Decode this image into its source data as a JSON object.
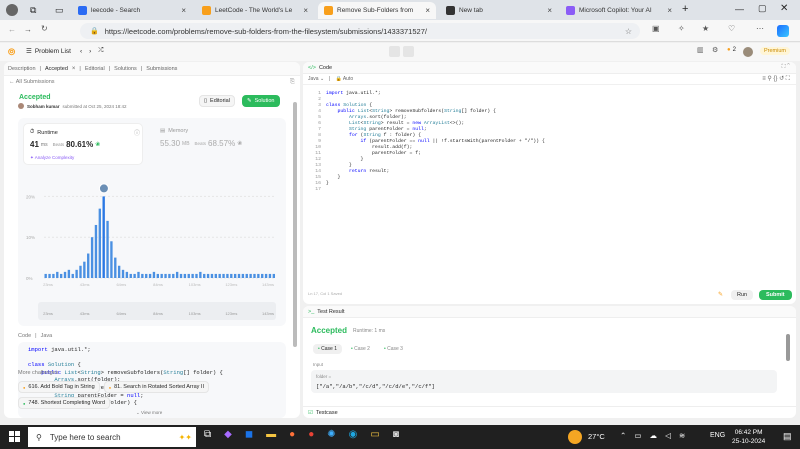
{
  "browser": {
    "tabs": [
      {
        "label": "leecode - Search",
        "color": "#2b6bf3",
        "active": false
      },
      {
        "label": "LeetCode - The World's Le",
        "color": "#f89f1b",
        "active": false
      },
      {
        "label": "Remove Sub-Folders from",
        "color": "#f89f1b",
        "active": true
      },
      {
        "label": "New tab",
        "color": "#333333",
        "active": false
      },
      {
        "label": "Microsoft Copilot: Your AI",
        "color": "#8b5cf6",
        "active": false
      }
    ],
    "url": "https://leetcode.com/problems/remove-sub-folders-from-the-filesystem/submissions/1433371527/"
  },
  "lc": {
    "problem_list": "Problem List",
    "premium": "Premium",
    "streak": "2"
  },
  "left": {
    "tabs": [
      "Description",
      "Accepted",
      "Editorial",
      "Solutions",
      "Submissions"
    ],
    "back": "All Submissions",
    "status": "Accepted",
    "user": "Sobham kumar",
    "submitted": "submitted at Oct 25, 2024 18:42",
    "editorial_btn": "Editorial",
    "solution_btn": "Solution",
    "runtime_label": "Runtime",
    "runtime_value": "41",
    "runtime_unit": "ms",
    "beats_label": "Beats",
    "runtime_beats": "80.61%",
    "analyze": "Analyze Complexity",
    "memory_label": "Memory",
    "memory_value": "55.30",
    "memory_unit": "MB",
    "memory_beats": "68.57%",
    "y_ticks": [
      "20%",
      "10%",
      "0%"
    ],
    "x_ticks": [
      "23ms",
      "43ms",
      "64ms",
      "84ms",
      "103ms",
      "123ms",
      "143ms"
    ],
    "code_label": "Code",
    "lang": "Java",
    "view_more": "View more",
    "more_label": "More challenges",
    "challenges": [
      "616. Add Bold Tag in String",
      "81. Search in Rotated Sorted Array II",
      "748. Shortest Completing Word"
    ]
  },
  "chart_data": {
    "type": "bar",
    "title": "",
    "xlabel": "",
    "ylabel": "",
    "ylim": [
      0,
      25
    ],
    "values": [
      1,
      1,
      1,
      1.5,
      1,
      1.5,
      2,
      1,
      2,
      3,
      4,
      6,
      10,
      13,
      17,
      20,
      14,
      9,
      5,
      3,
      2,
      1.5,
      1,
      1,
      1.5,
      1,
      1,
      1,
      1.5,
      1,
      1,
      1,
      1,
      1,
      1.5,
      1,
      1,
      1,
      1,
      1,
      1.5,
      1,
      1,
      1,
      1,
      1,
      1,
      1,
      1,
      1,
      1,
      1,
      1,
      1,
      1,
      1,
      1,
      1,
      1,
      1
    ],
    "highlight_index": 15
  },
  "code": {
    "header": "Code",
    "lang": "Java",
    "auto": "Auto",
    "lines": [
      "import java.util.*;",
      "",
      "class Solution {",
      "    public List<String> removeSubfolders(String[] folder) {",
      "        Arrays.sort(folder);",
      "        List<String> result = new ArrayList<>();",
      "        String parentFolder = null;",
      "        for (String f : folder) {",
      "            if (parentFolder == null || !f.startsWith(parentFolder + \"/\")) {",
      "                result.add(f);",
      "                parentFolder = f;",
      "            }",
      "        }",
      "        return result;",
      "    }",
      "}",
      ""
    ],
    "status": "Ln 17, Col 1    Saved",
    "run": "Run",
    "submit": "Submit"
  },
  "result": {
    "header": "Test Result",
    "status": "Accepted",
    "runtime": "Runtime: 1 ms",
    "cases": [
      "Case 1",
      "Case 2",
      "Case 3"
    ],
    "input_label": "Input",
    "param": "folder =",
    "value": "[\"/a\",\"/a/b\",\"/c/d\",\"/c/d/e\",\"/c/f\"]",
    "testcase": "Testcase"
  },
  "taskbar": {
    "search": "Type here to search",
    "temp": "27°C",
    "lang": "ENG",
    "time": "06:42 PM",
    "date": "25-10-2024"
  }
}
